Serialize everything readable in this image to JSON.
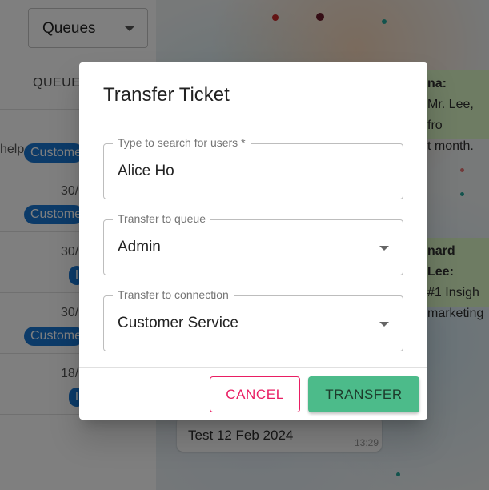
{
  "queues_panel": {
    "select_label": "Queues",
    "column_header": "QUEUE",
    "tickets": [
      {
        "snippet": "help",
        "date": "",
        "badge": "Customer Service"
      },
      {
        "snippet": "",
        "date": "30/",
        "badge": "Customer Service"
      },
      {
        "snippet": "",
        "date": "30/",
        "badge": "I"
      },
      {
        "snippet": "",
        "date": "30/",
        "badge": "Customer Service"
      },
      {
        "snippet": "",
        "date": "18/",
        "badge": "I"
      }
    ]
  },
  "chat": {
    "bubble_top": {
      "author": "na:",
      "lines": [
        "Mr. Lee, fro",
        "t month."
      ]
    },
    "bubble_mid": {
      "author": "nard Lee:",
      "lines": [
        "#1 Insigh",
        "marketing"
      ]
    },
    "bubble_bottom": {
      "text": "Test 12 Feb 2024",
      "time": "13:29"
    }
  },
  "dialog": {
    "title": "Transfer Ticket",
    "user_search": {
      "label": "Type to search for users *",
      "value": "Alice Ho"
    },
    "queue_select": {
      "label": "Transfer to queue",
      "value": "Admin"
    },
    "connection_select": {
      "label": "Transfer to connection",
      "value": "Customer Service"
    },
    "cancel_label": "CANCEL",
    "transfer_label": "TRANSFER"
  },
  "colors": {
    "badge": "#1976d2",
    "cancel": "#e91e63",
    "transfer": "#4cbb8a",
    "bubble_green": "#dcf8c6"
  }
}
